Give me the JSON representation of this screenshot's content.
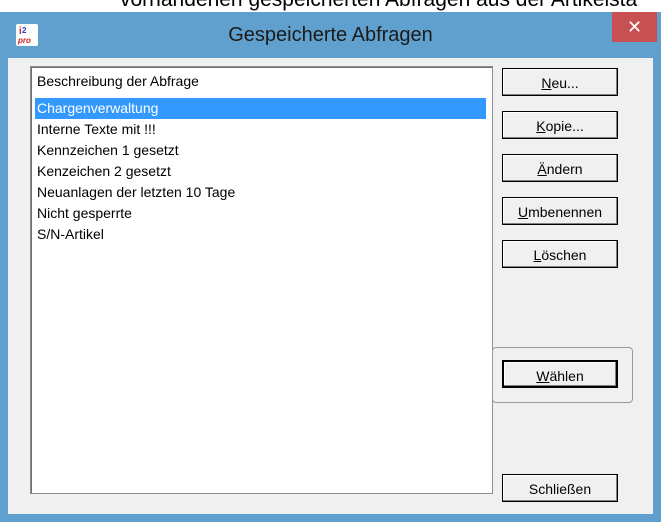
{
  "background_text": "vorhandenen gespeicherten Abfragen aus der Artikelsta",
  "window": {
    "title": "Gespeicherte Abfragen",
    "close_label": "✕",
    "app_icon": "i-pro-app-icon"
  },
  "list": {
    "header": "Beschreibung der Abfrage",
    "items": [
      "Chargenverwaltung",
      "Interne Texte mit !!!",
      "Kennzeichen 1 gesetzt",
      "Kenzeichen 2 gesetzt",
      "Neuanlagen der letzten 10 Tage",
      "Nicht gesperrte",
      "S/N-Artikel"
    ],
    "selected_index": 0
  },
  "buttons": {
    "neu": {
      "ul": "N",
      "rest": "eu..."
    },
    "kopie": {
      "ul": "K",
      "rest": "opie..."
    },
    "aendern": {
      "ul": "Ä",
      "rest": "ndern"
    },
    "umbenennen": {
      "ul": "U",
      "rest": "mbenennen"
    },
    "loeschen": {
      "ul": "L",
      "rest": "öschen"
    },
    "waehlen": {
      "ul": "W",
      "rest": "ählen"
    },
    "schliessen": {
      "label": "Schließen"
    }
  },
  "colors": {
    "frame": "#60a0cf",
    "close": "#c75050",
    "selection": "#3399ff"
  }
}
